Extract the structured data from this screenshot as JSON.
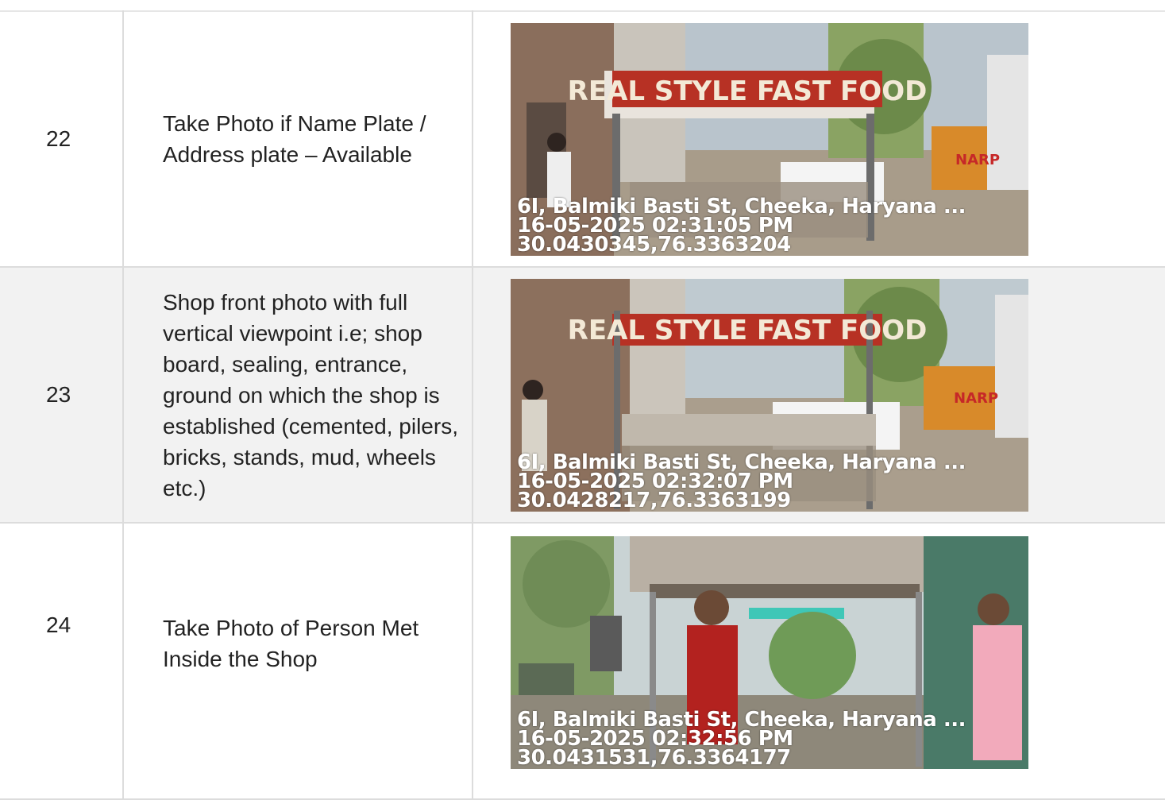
{
  "rows": [
    {
      "number": "22",
      "description": "Take Photo if Name Plate / Address plate – Available",
      "photo": {
        "sign_text": "REAL STYLE FAST FOOD",
        "sign_side": "NARP",
        "address": "6I, Balmiki Basti St, Cheeka, Haryana ...",
        "datetime": "16-05-2025 02:31:05 PM",
        "coords": "30.0430345,76.3363204"
      }
    },
    {
      "number": "23",
      "description": "Shop front photo with full vertical viewpoint i.e; shop board, sealing, entrance, ground on which the shop is established (cemented, pilers, bricks, stands, mud, wheels etc.)",
      "photo": {
        "sign_text": "REAL STYLE FAST FOOD",
        "sign_side": "NARP",
        "address": "6I, Balmiki Basti St, Cheeka, Haryana ...",
        "datetime": "16-05-2025 02:32:07 PM",
        "coords": "30.0428217,76.3363199"
      }
    },
    {
      "number": "24",
      "description": "Take Photo of Person Met Inside the Shop",
      "photo": {
        "address": "6I, Balmiki Basti St, Cheeka, Haryana ...",
        "datetime": "16-05-2025 02:32:56 PM",
        "coords": "30.0431531,76.3364177"
      }
    }
  ]
}
